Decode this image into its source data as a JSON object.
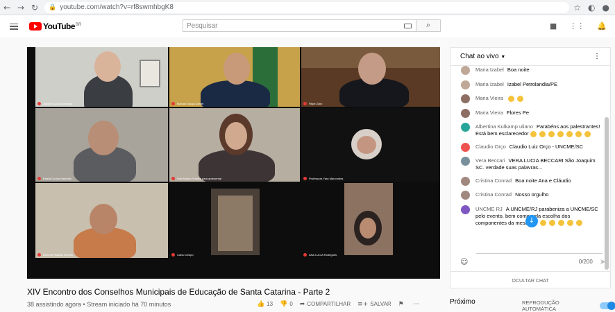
{
  "browser": {
    "url": "youtube.com/watch?v=rf8swmhbgK8"
  },
  "header": {
    "logo_text": "YouTube",
    "logo_region": "BR",
    "search_placeholder": "Pesquisar"
  },
  "video": {
    "participants": [
      "Josiane Lucia Camargo",
      "Marcos Sousa Daniel",
      "Filipe Zolin",
      "Estela Cunha Sabarido",
      "Fabi Matos Ferreira para apresentar",
      "Professora Yara Marcondes",
      "Dark de Ricardo Gomes",
      "Carla Crespo",
      "ANA LUCIA Rodrigues"
    ],
    "title": "XIV Encontro dos Conselhos Municipais de Educação de Santa Catarina - Parte 2",
    "meta": "38 assistindo agora • Stream iniciado há 70 minutos",
    "likes": "13",
    "dislikes": "0",
    "share_label": "COMPARTILHAR",
    "save_label": "SALVAR"
  },
  "chat": {
    "header": "Chat ao vivo",
    "messages": [
      {
        "author": "Maria Izabel",
        "text": "Boa noite",
        "avatar_color": "#bfa898",
        "emojis": 0
      },
      {
        "author": "Maria Izabel",
        "text": "Izabel Petrolandia/PE",
        "avatar_color": "#bfa898",
        "emojis": 0
      },
      {
        "author": "Maria Vieira",
        "text": "",
        "avatar_color": "#8d6e63",
        "emojis": 2
      },
      {
        "author": "Maria Vieira",
        "text": "Flores Pe",
        "avatar_color": "#8d6e63",
        "emojis": 0
      },
      {
        "author": "Albertina Kulkamp uliano",
        "text": "Parabéns aos palestrantes! Está bem esclarecedor",
        "avatar_color": "#26a69a",
        "emojis": 7
      },
      {
        "author": "Claudio Orço",
        "text": "Claudio Luiz Orço - UNCME/SC",
        "avatar_color": "#ef5350",
        "emojis": 0
      },
      {
        "author": "Vera Beccari",
        "text": "VERA LUCIA BECCARI São Joaquim SC. verdade suas palavras...",
        "avatar_color": "#78909c",
        "emojis": 0
      },
      {
        "author": "Cristina Conrad",
        "text": "Boa noite Ana e Cláudio",
        "avatar_color": "#a1887f",
        "emojis": 0
      },
      {
        "author": "Cristina Conrad",
        "text": "Nosso orgulho",
        "avatar_color": "#a1887f",
        "emojis": 0
      },
      {
        "author": "UNCME RJ",
        "text": "A UNCME/RJ parabeniza a UNCME/SC pelo evento, bem como pela escolha dos componentes da mesa.",
        "avatar_color": "#7e57c2",
        "emojis": 6
      }
    ],
    "char_count": "0/200",
    "hide_label": "OCULTAR CHAT"
  },
  "sidebar": {
    "next_label": "Próximo",
    "autoplay_label": "REPRODUÇÃO AUTOMÁTICA"
  }
}
